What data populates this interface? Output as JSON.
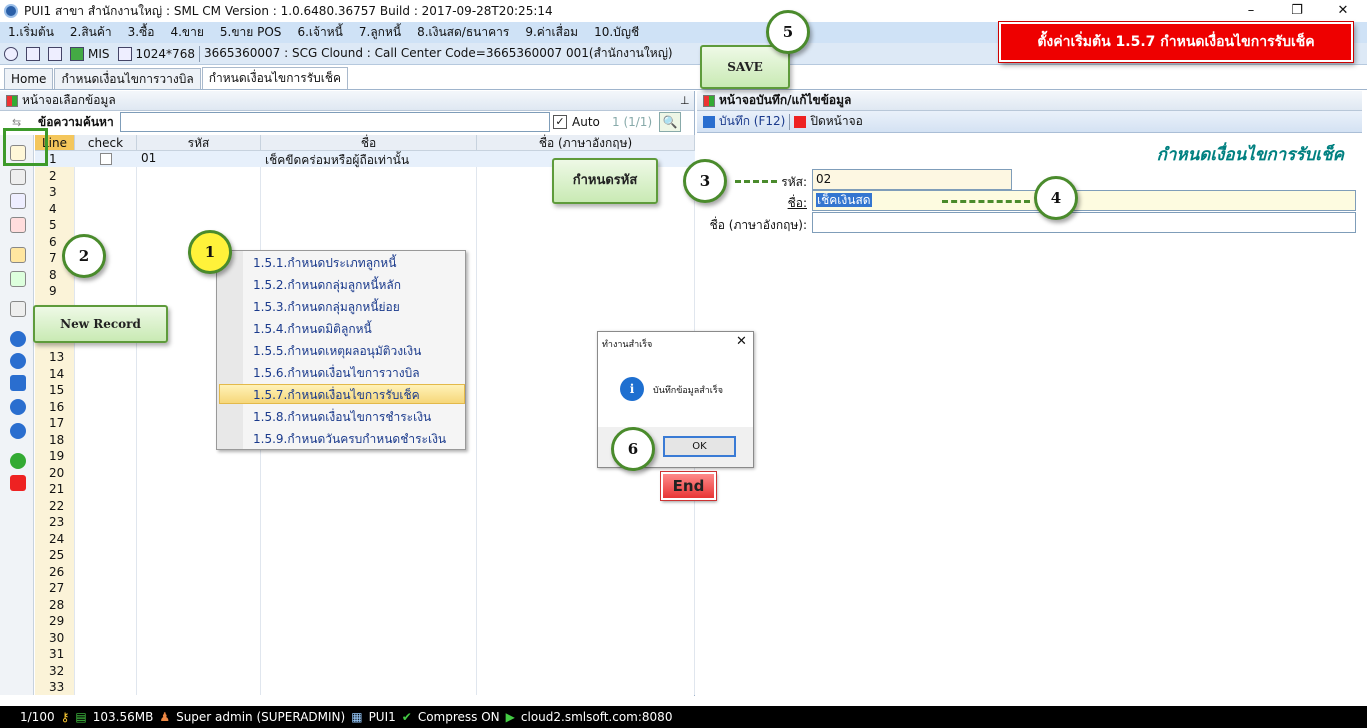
{
  "window": {
    "title": "PUI1 สาขา สำนักงานใหญ่ : SML CM Version : 1.0.6480.36757  Build : 2017-09-28T20:25:14",
    "min": "–",
    "max": "❐",
    "close": "✕"
  },
  "menu": [
    "1.เริ่มต้น",
    "2.สินค้า",
    "3.ซื้อ",
    "4.ขาย",
    "5.ขาย POS",
    "6.เจ้าหนี้",
    "7.ลูกหนี้",
    "8.เงินสด/ธนาคาร",
    "9.ค่าเสื่อม",
    "10.บัญชี"
  ],
  "info": {
    "mis": "MIS",
    "res": "1024*768",
    "company": "3665360007 : SCG Clound : Call Center Code=3665360007 001(สำนักงานใหญ่)"
  },
  "tabs": [
    "Home",
    "กำหนดเงื่อนไขการวางบิล",
    "กำหนดเงื่อนไขการรับเช็ค"
  ],
  "left": {
    "title": "หน้าจอเลือกข้อมูล",
    "search_label": "ข้อความค้นหา",
    "auto": "Auto",
    "page": "1 (1/1)",
    "columns": [
      "Line",
      "check",
      "รหัส",
      "ชื่อ",
      "ชื่อ (ภาษาอังกฤษ)"
    ],
    "row1": {
      "line": "1",
      "code": "01",
      "name": "เช็คขีดคร่อมหรือผู้ถือเท่านั้น"
    },
    "lines": [
      "2",
      "3",
      "4",
      "5",
      "6",
      "7",
      "8",
      "9",
      "13",
      "14",
      "15",
      "16",
      "17",
      "18",
      "19",
      "20",
      "21",
      "22",
      "23",
      "24",
      "25",
      "26",
      "27",
      "28",
      "29",
      "30",
      "31",
      "32",
      "33"
    ]
  },
  "right": {
    "title": "หน้าจอบันทึก/แก้ไขข้อมูล",
    "save": "บันทึก (F12)",
    "close": "ปิดหน้าจอ",
    "form_title": "กำหนดเงื่อนไขการรับเช็ค",
    "code_label": "รหัส:",
    "code_value": "02",
    "name_label": "ชื่อ:",
    "name_value": "เช็คเงินสด",
    "name_en_label": "ชื่อ (ภาษาอังกฤษ):",
    "name_en_value": ""
  },
  "context_menu": [
    "1.5.1.กำหนดประเภทลูกหนี้",
    "1.5.2.กำหนดกลุ่มลูกหนี้หลัก",
    "1.5.3.กำหนดกลุ่มลูกหนี้ย่อย",
    "1.5.4.กำหนดมิติลูกหนี้",
    "1.5.5.กำหนดเหตุผลอนุมัติวงเงิน",
    "1.5.6.กำหนดเงื่อนไขการวางบิล",
    "1.5.7.กำหนดเงื่อนไขการรับเช็ค",
    "1.5.8.กำหนดเงื่อนไขการชำระเงิน",
    "1.5.9.กำหนดวันครบกำหนดชำระเงิน"
  ],
  "dialog": {
    "title": "ทำงานสำเร็จ",
    "message": "บันทึกข้อมูลสำเร็จ",
    "ok": "OK"
  },
  "annotations": {
    "banner": "ตั้งค่าเริ่มต้น 1.5.7 กำหนดเงื่อนไขการรับเช็ค",
    "save": "SAVE",
    "new_record": "New Record",
    "set_code": "กำหนดรหัส",
    "end": "End",
    "n1": "1",
    "n2": "2",
    "n3": "3",
    "n4": "4",
    "n5": "5",
    "n6": "6"
  },
  "status": {
    "pages": "1/100",
    "mem": "103.56MB",
    "user": "Super admin (SUPERADMIN)",
    "db": "PUI1",
    "compress": "Compress ON",
    "server": "cloud2.smlsoft.com:8080"
  },
  "colors": {
    "accent": "#008080",
    "banner": "#ee0000",
    "annotation_green": "#4a8b2c"
  }
}
